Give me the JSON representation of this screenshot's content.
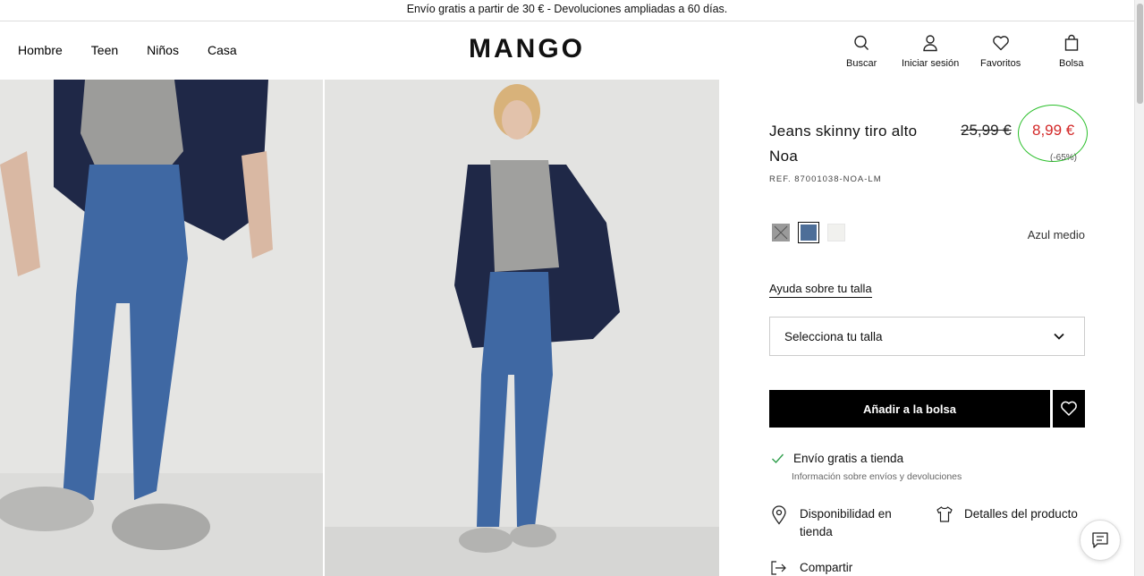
{
  "promo": {
    "text": "Envío gratis a partir de 30 € - Devoluciones ampliadas a 60 días."
  },
  "header": {
    "nav": [
      "Hombre",
      "Teen",
      "Niños",
      "Casa"
    ],
    "logo": "MANGO",
    "actions": {
      "search": "Buscar",
      "login": "Iniciar sesión",
      "favorites": "Favoritos",
      "bag": "Bolsa"
    }
  },
  "product": {
    "title": "Jeans skinny tiro alto Noa",
    "old_price": "25,99 €",
    "new_price": "8,99 €",
    "discount": "(-65%)",
    "ref": "REF. 87001038-NOA-LM",
    "color_name": "Azul medio",
    "swatches": [
      {
        "name": "gris",
        "color": "#9a9a9a",
        "available": false
      },
      {
        "name": "azul medio",
        "color": "#4d6e98",
        "selected": true
      },
      {
        "name": "blanco",
        "color": "#f1f1ee"
      }
    ],
    "size_help": "Ayuda sobre tu talla",
    "size_placeholder": "Selecciona tu talla",
    "add_to_bag": "Añadir a la bolsa",
    "shipping_title": "Envío gratis a tienda",
    "shipping_sub": "Información sobre envíos y devoluciones",
    "availability": "Disponibilidad en tienda",
    "details": "Detalles del producto",
    "share": "Compartir"
  },
  "colors": {
    "price_red": "#d32828",
    "highlight_green": "#2bbf2b",
    "denim": "#3f68a3",
    "jacket_navy": "#1f2847"
  }
}
